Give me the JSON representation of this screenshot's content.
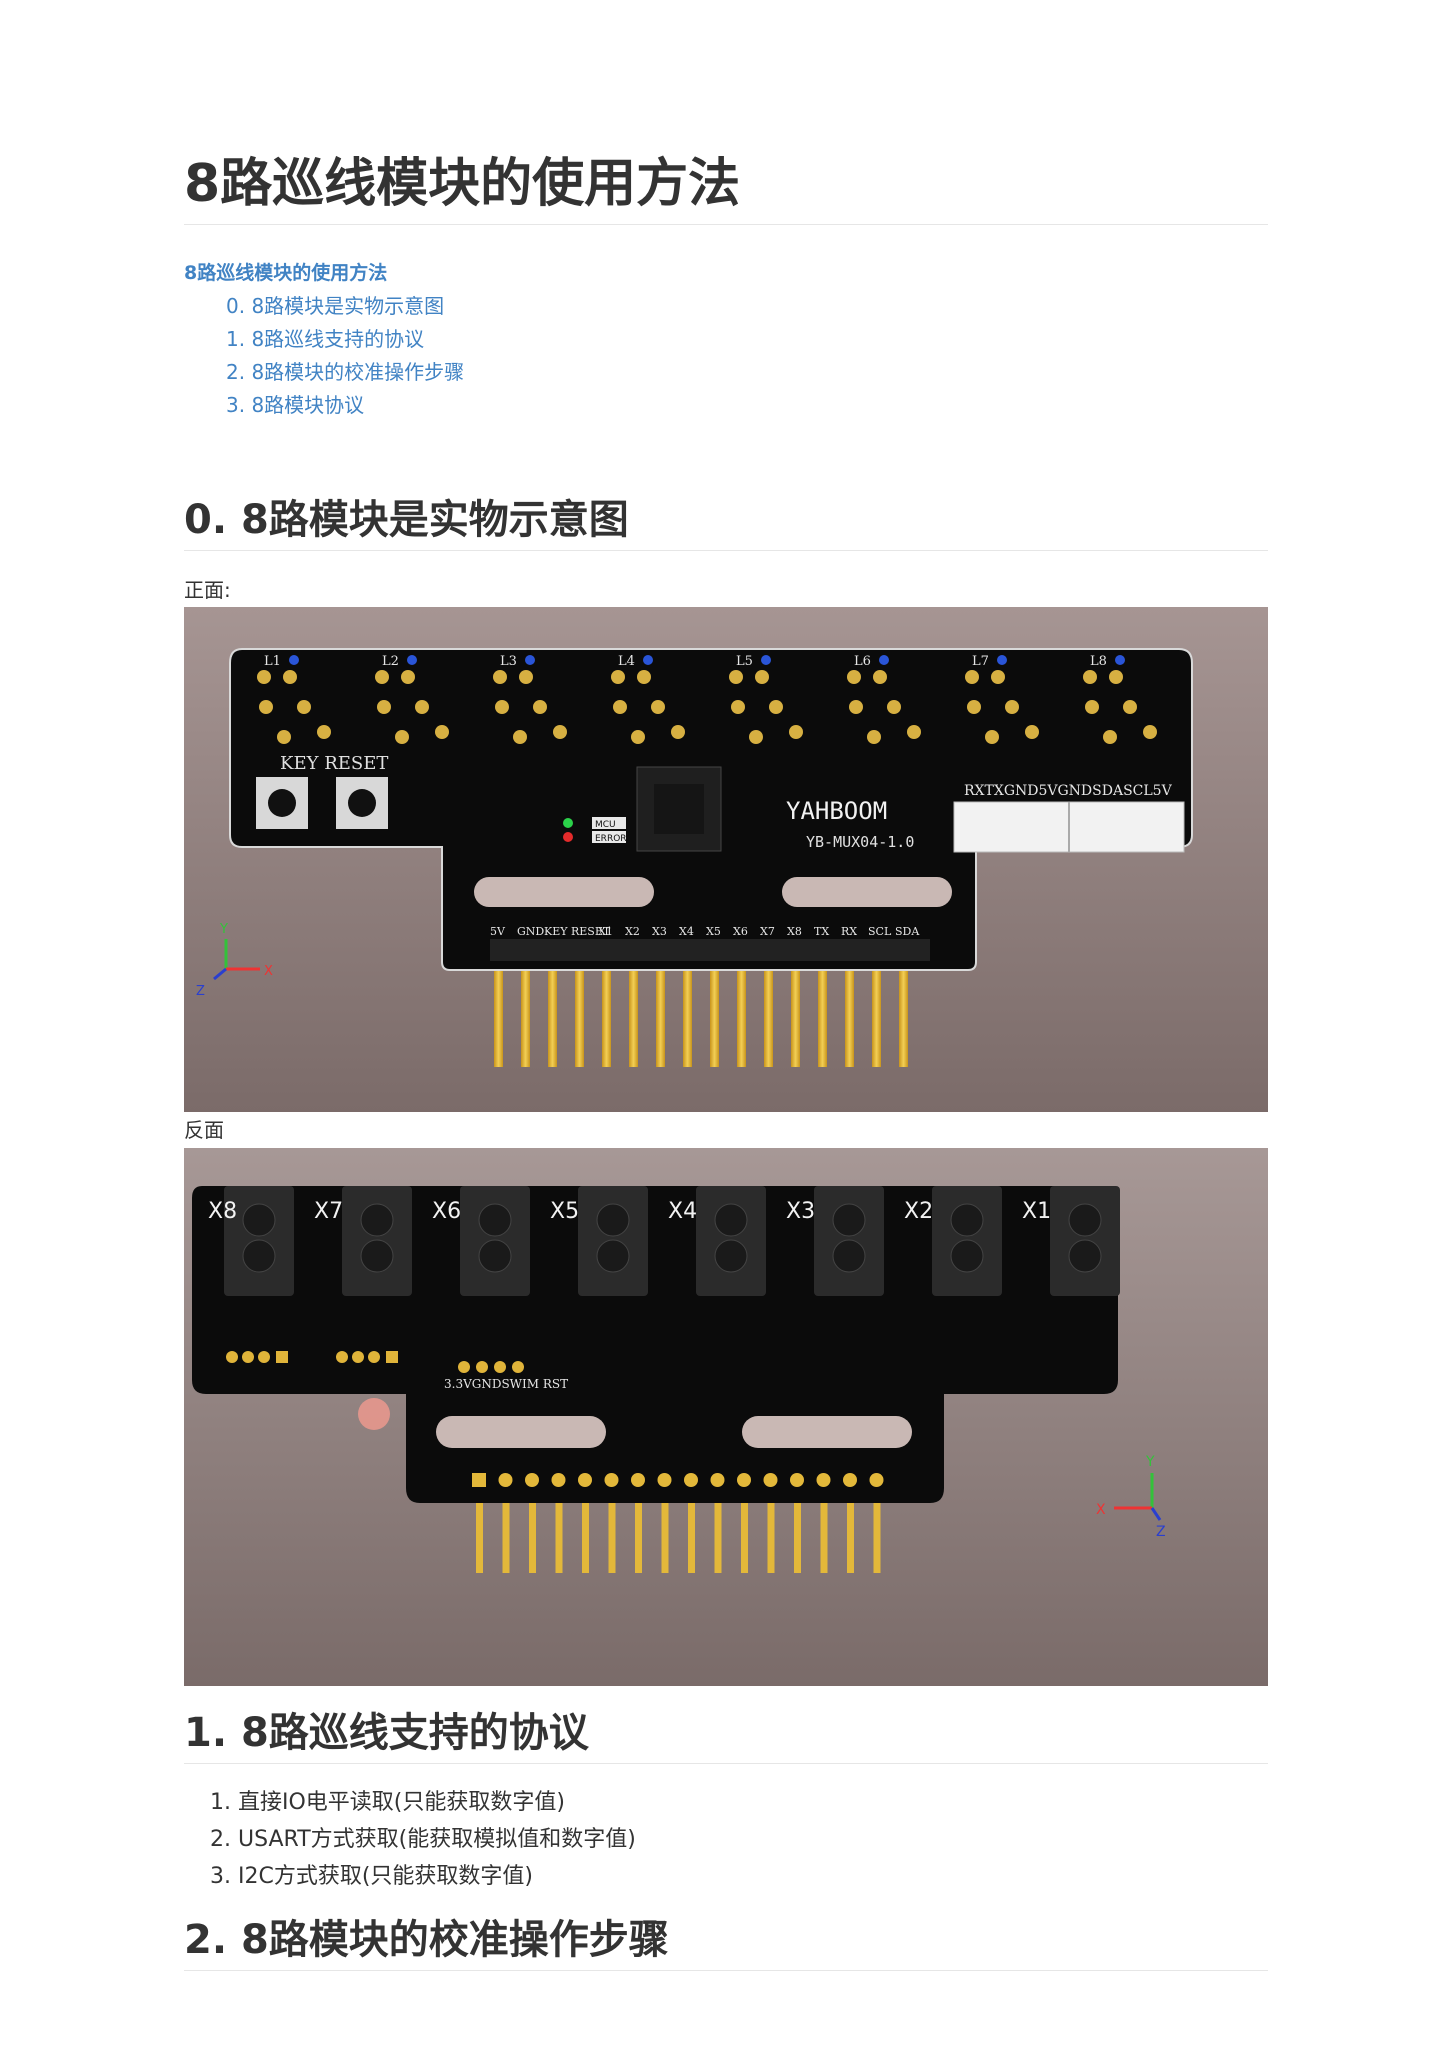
{
  "title": "8路巡线模块的使用方法",
  "toc": {
    "title": "8路巡线模块的使用方法",
    "items": [
      "0. 8路模块是实物示意图",
      "1. 8路巡线支持的协议",
      "2. 8路模块的校准操作步骤",
      "3. 8路模块协议"
    ]
  },
  "section0": {
    "heading": "0. 8路模块是实物示意图",
    "front_label": "正面:",
    "back_label": "反面"
  },
  "board_front": {
    "leds": [
      "L1",
      "L2",
      "L3",
      "L4",
      "L5",
      "L6",
      "L7",
      "L8"
    ],
    "key_reset": "KEY RESET",
    "brand": "YAHBOOM",
    "model": "YB-MUX04-1.0",
    "connector_label": "RXTXGND5VGNDSDASCL5V",
    "mcu_label": "MCU",
    "error_label": "ERROR",
    "pins": [
      "5V",
      "GND",
      "KEY",
      "RESET",
      "X1",
      "X2",
      "X3",
      "X4",
      "X5",
      "X6",
      "X7",
      "X8",
      "TX",
      "RX",
      "SCL",
      "SDA"
    ],
    "axis": [
      "Y",
      "X",
      "Z"
    ]
  },
  "board_back": {
    "sensors": [
      "X8",
      "X7",
      "X6",
      "X5",
      "X4",
      "X3",
      "X2",
      "X1"
    ],
    "swim_label": "3.3VGNDSWIM RST",
    "axis": [
      "Y",
      "X",
      "Z"
    ]
  },
  "section1": {
    "heading": "1. 8路巡线支持的协议",
    "items": [
      "直接IO电平读取(只能获取数字值)",
      "USART方式获取(能获取模拟值和数字值)",
      "I2C方式获取(只能获取数字值)"
    ]
  },
  "section2": {
    "heading": "2. 8路模块的校准操作步骤"
  },
  "colors": {
    "link": "#4183c4",
    "pcb": "#0c0c0c",
    "pin_gold": "#e8b830",
    "bg_photo": "#8b7b79"
  }
}
